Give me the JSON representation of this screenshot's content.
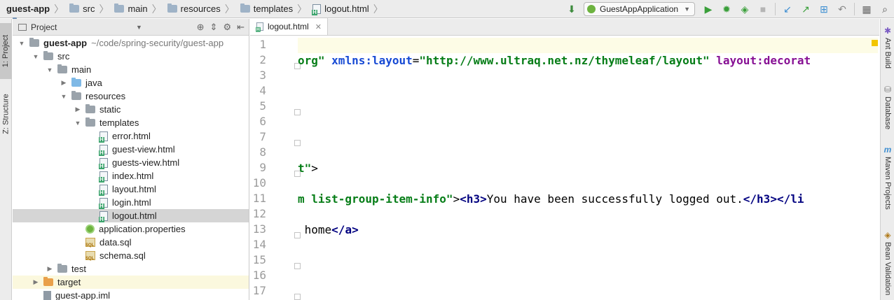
{
  "breadcrumbs": [
    {
      "label": "guest-app",
      "icon": "project-folder-icon",
      "bold": true
    },
    {
      "label": "src",
      "icon": "folder-icon",
      "bold": false
    },
    {
      "label": "main",
      "icon": "folder-icon",
      "bold": false
    },
    {
      "label": "resources",
      "icon": "folder-icon",
      "bold": false
    },
    {
      "label": "templates",
      "icon": "folder-icon",
      "bold": false
    },
    {
      "label": "logout.html",
      "icon": "html-file-icon",
      "bold": false
    }
  ],
  "toolbar": {
    "run_config": "GuestAppApplication",
    "icons": [
      "build-icon",
      "run-icon",
      "debug-icon",
      "coverage-icon",
      "stop-icon",
      "vcs-update-icon",
      "vcs-commit-icon",
      "vcs-history-icon",
      "revert-icon",
      "project-structure-icon",
      "search-icon"
    ]
  },
  "left_stripe": {
    "tabs": [
      "1: Project",
      "Z: Structure"
    ]
  },
  "project_panel": {
    "title": "Project",
    "tools": [
      "locate-icon",
      "collapse-icon",
      "settings-icon",
      "hide-icon"
    ],
    "tree": [
      {
        "label": "guest-app",
        "sub": "~/code/spring-security/guest-app",
        "arrow": "▼",
        "icon": "module-folder"
      },
      {
        "label": "src",
        "arrow": "▼",
        "icon": "folder"
      },
      {
        "label": "main",
        "arrow": "▼",
        "icon": "folder"
      },
      {
        "label": "java",
        "arrow": "▶",
        "icon": "source-folder"
      },
      {
        "label": "resources",
        "arrow": "▼",
        "icon": "resource-folder"
      },
      {
        "label": "static",
        "arrow": "▶",
        "icon": "folder"
      },
      {
        "label": "templates",
        "arrow": "▼",
        "icon": "folder"
      },
      {
        "label": "error.html",
        "arrow": "",
        "icon": "html-file"
      },
      {
        "label": "guest-view.html",
        "arrow": "",
        "icon": "html-file"
      },
      {
        "label": "guests-view.html",
        "arrow": "",
        "icon": "html-file"
      },
      {
        "label": "index.html",
        "arrow": "",
        "icon": "html-file"
      },
      {
        "label": "layout.html",
        "arrow": "",
        "icon": "html-file"
      },
      {
        "label": "login.html",
        "arrow": "",
        "icon": "html-file"
      },
      {
        "label": "logout.html",
        "arrow": "",
        "icon": "html-file"
      },
      {
        "label": "application.properties",
        "arrow": "",
        "icon": "properties-file"
      },
      {
        "label": "data.sql",
        "arrow": "",
        "icon": "sql-file"
      },
      {
        "label": "schema.sql",
        "arrow": "",
        "icon": "sql-file"
      },
      {
        "label": "test",
        "arrow": "▶",
        "icon": "folder"
      },
      {
        "label": "target",
        "arrow": "▶",
        "icon": "excluded-folder"
      },
      {
        "label": "guest-app.iml",
        "arrow": "",
        "icon": "iml-file"
      }
    ]
  },
  "editor": {
    "tab": "logout.html",
    "line_numbers": [
      "1",
      "2",
      "3",
      "4",
      "5",
      "6",
      "7",
      "8",
      "9",
      "10",
      "11",
      "12",
      "13",
      "14",
      "15",
      "16",
      "17"
    ],
    "lines": [
      [],
      [
        {
          "t": "org\"",
          "c": "str"
        },
        {
          "t": " ",
          "c": "txt"
        },
        {
          "t": "xmlns:layout",
          "c": "attr"
        },
        {
          "t": "=",
          "c": "txt"
        },
        {
          "t": "\"http://www.ultraq.net.nz/thymeleaf/layout\"",
          "c": "str"
        },
        {
          "t": " ",
          "c": "txt"
        },
        {
          "t": "layout:decorat",
          "c": "ns"
        }
      ],
      [],
      [],
      [],
      [],
      [],
      [],
      [
        {
          "t": "t\"",
          "c": "str"
        },
        {
          "t": ">",
          "c": "txt"
        }
      ],
      [],
      [
        {
          "t": "m list-group-item-info\"",
          "c": "str"
        },
        {
          "t": ">",
          "c": "txt"
        },
        {
          "t": "<h3>",
          "c": "tag"
        },
        {
          "t": "You have been successfully logged out.",
          "c": "txt"
        },
        {
          "t": "</h3></li",
          "c": "tag"
        }
      ],
      [],
      [
        {
          "t": " home",
          "c": "txt"
        },
        {
          "t": "</a>",
          "c": "tag"
        }
      ],
      [],
      [],
      [],
      []
    ]
  },
  "right_stripe": {
    "tabs": [
      {
        "label": "Ant Build",
        "icon": "ant-icon"
      },
      {
        "label": "Database",
        "icon": "database-icon"
      },
      {
        "label": "Maven Projects",
        "icon": "maven-icon"
      },
      {
        "label": "Bean Validation",
        "icon": "bean-icon"
      }
    ]
  }
}
